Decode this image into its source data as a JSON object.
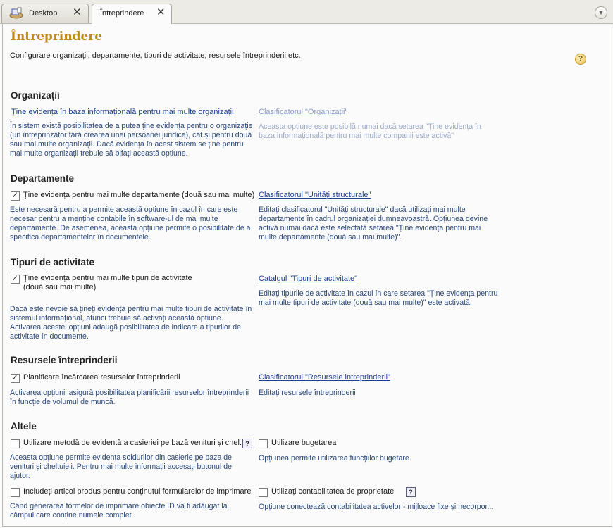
{
  "tabs": [
    {
      "label": "Desktop",
      "close": "✕",
      "icon": "desktop-icon"
    },
    {
      "label": "Întreprindere",
      "close": "✕"
    }
  ],
  "page": {
    "title": "Întreprindere",
    "description": "Configurare organizații, departamente, tipuri de activitate, resursele întreprinderii etc.",
    "help": "?"
  },
  "organizatii": {
    "heading": "Organizații",
    "left_link": "Ține evidența în baza informațională pentru mai multe organizații",
    "left_desc": "În sistem există posibilitatea de a putea ține evidența pentru o organizație (un întreprinzător fără crearea unei persoanei juridice), cât și pentru două sau mai multe organizații. Dacă evidența în acest sistem se ține pentru mai multe organizații trebuie să bifați această opțiune.",
    "right_link": "Clasificatorul \"Organizații\"",
    "right_desc": "Aceasta opțiune este posibilă numai dacă setarea \"Ține evidența în baza informațională pentru mai multe companii este activă\""
  },
  "departamente": {
    "heading": "Departamente",
    "checkbox": "Ține evidența pentru mai multe departamente (două sau mai multe)",
    "checked": true,
    "left_desc": "Este necesară pentru a permite această opțiune în cazul în care este necesar pentru a menține contabile în software-ul de mai multe departamente. De asemenea, această opțiune permite o posibilitate de a specifica departamentelor în documentele.",
    "right_link": "Clasificatorul \"Unități structurale\"",
    "right_desc": "Editați clasificatorul \"Unități structurale\" dacă utilizați mai multe departamente în cadrul organizației dumneavoastră. Opțiunea devine activă numai dacă este selectată setarea \"Ține evidența pentru mai multe departamente (două sau mai multe)\"."
  },
  "tipuri": {
    "heading": "Tipuri de activitate",
    "checkbox_line1": "Ține evidența pentru mai multe tipuri de activitate",
    "checkbox_line2": "(două sau mai multe)",
    "checked": true,
    "left_desc": "Dacă este nevoie să țineți evidența pentru mai multe tipuri de activitate în sistemul informațional, atunci trebuie să activați această opțiune. Activarea acestei opțiuni adaugă posibilitatea de indicare a tipurilor de activitate în documente.",
    "right_link": "Catalgul \"Tipuri de activitate\"",
    "right_desc": "Editați tipurile de activitate în cazul în care setarea \"Ține evidența pentru mai multe tipuri de activitate (două sau mai multe)\" este activată."
  },
  "resurse": {
    "heading": "Resursele întreprinderii",
    "checkbox": "Planificare încărcarea resurselor întreprinderii",
    "checked": true,
    "left_desc": "Activarea opțiunii asigură posibilitatea planificării resurselor întreprinderii în funcție de volumul de muncă.",
    "right_link": "Clasificatorul \"Resursele intreprinderii\"",
    "right_desc": "Editați resursele întreprinderii"
  },
  "altele": {
    "heading": "Altele",
    "cb1": "Utilizare metodă de evidentă a casieriei pe bază venituri și chel...",
    "cb1_checked": false,
    "cb1_help": "?",
    "cb1_desc": "Aceasta opțiune permite evidența soldurilor din casierie pe baza de venituri și cheltuieli. Pentru mai multe informații accesați butonul de ajutor.",
    "cb2": "Utilizare bugetarea",
    "cb2_checked": false,
    "cb2_desc": "Opțiunea permite utilizarea funcțiilor bugetare.",
    "cb3": "Includeți articol produs pentru conținutul formularelor de imprimare",
    "cb3_checked": false,
    "cb3_desc": "Când generarea formelor de imprimare obiecte ID va fi adăugat la câmpul care conține numele complet.",
    "cb4": "Utilizați contabilitatea de proprietate",
    "cb4_checked": false,
    "cb4_help": "?",
    "cb4_desc": "Opțiune conectează contabilitatea activelor - mijloace fixe și necorpor..."
  },
  "colors": {
    "title": "#c08a17",
    "link": "#1e3f93",
    "desc": "#29477a",
    "disabled": "#9aa8c8"
  }
}
